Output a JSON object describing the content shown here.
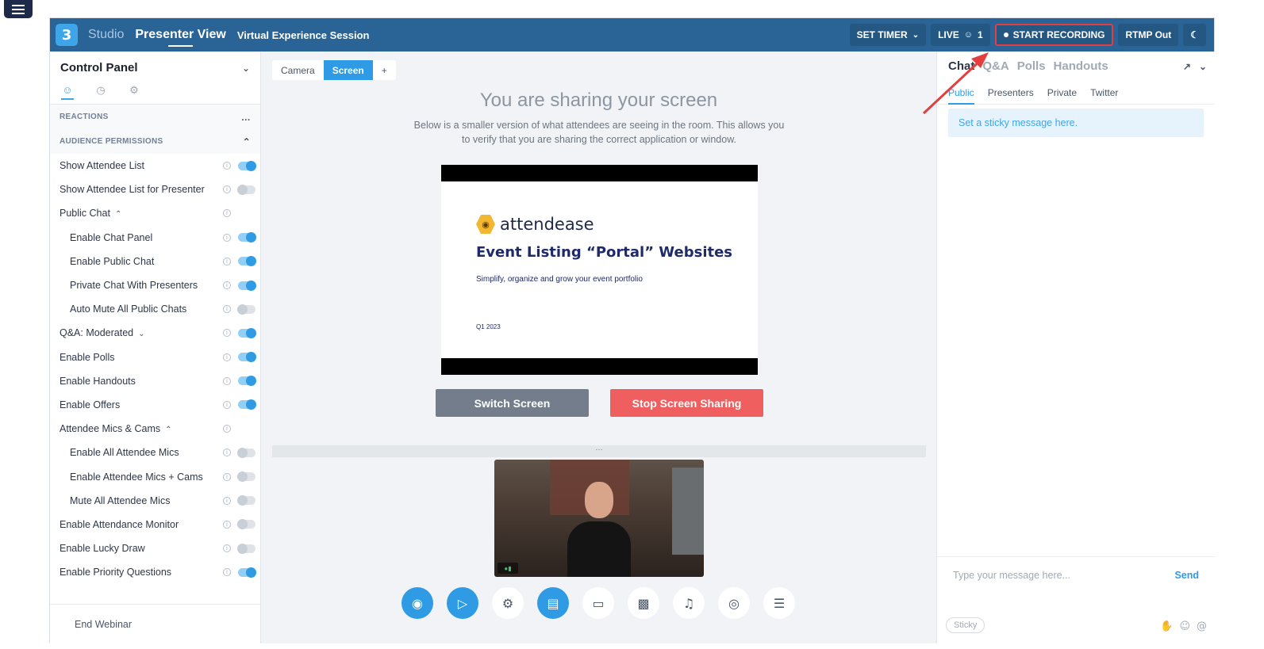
{
  "topbar": {
    "studio_label": "Studio",
    "presenter_view_label": "Presenter View",
    "session_title": "Virtual Experience Session",
    "set_timer_label": "SET TIMER",
    "live_label": "LIVE",
    "attendee_count": "1",
    "start_recording_label": "START RECORDING",
    "rtmp_label": "RTMP Out"
  },
  "control_panel": {
    "title": "Control Panel",
    "reactions_label": "REACTIONS",
    "reactions_more": "…",
    "audience_permissions_label": "AUDIENCE PERMISSIONS",
    "permissions": [
      {
        "label": "Show Attendee List",
        "on": true,
        "sub": false
      },
      {
        "label": "Show Attendee List for Presenter",
        "on": false,
        "sub": false
      },
      {
        "label": "Public Chat",
        "caret": "up",
        "sub": false,
        "toggle": false
      },
      {
        "label": "Enable Chat Panel",
        "on": true,
        "sub": true
      },
      {
        "label": "Enable Public Chat",
        "on": true,
        "sub": true
      },
      {
        "label": "Private Chat With Presenters",
        "on": true,
        "sub": true
      },
      {
        "label": "Auto Mute All Public Chats",
        "on": false,
        "sub": true
      },
      {
        "label": "Q&A: Moderated",
        "caret": "down",
        "on": true,
        "sub": false
      },
      {
        "label": "Enable Polls",
        "on": true,
        "sub": false
      },
      {
        "label": "Enable Handouts",
        "on": true,
        "sub": false
      },
      {
        "label": "Enable Offers",
        "on": true,
        "sub": false
      },
      {
        "label": "Attendee Mics & Cams",
        "caret": "up",
        "sub": false,
        "toggle": false
      },
      {
        "label": "Enable All Attendee Mics",
        "on": false,
        "sub": true
      },
      {
        "label": "Enable Attendee Mics + Cams",
        "on": false,
        "sub": true
      },
      {
        "label": "Mute All Attendee Mics",
        "on": false,
        "sub": true
      },
      {
        "label": "Enable Attendance Monitor",
        "on": false,
        "sub": false
      },
      {
        "label": "Enable Lucky Draw",
        "on": false,
        "sub": false
      },
      {
        "label": "Enable Priority Questions",
        "on": true,
        "sub": false
      }
    ],
    "end_webinar_label": "End Webinar"
  },
  "center": {
    "tabs": [
      "Camera",
      "Screen",
      "+"
    ],
    "share_title": "You are sharing your screen",
    "share_desc": "Below is a smaller version of what attendees are seeing in the room. This allows you to verify that you are sharing the correct application or window.",
    "slide": {
      "brand": "attendease",
      "title": "Event Listing “Portal” Websites",
      "subtitle": "Simplify, organize and grow your event portfolio",
      "date": "Q1 2023"
    },
    "switch_screen_label": "Switch Screen",
    "stop_sharing_label": "Stop Screen Sharing",
    "divider_handle": "…"
  },
  "chat": {
    "tabs": [
      "Chat",
      "Q&A",
      "Polls",
      "Handouts"
    ],
    "subtabs": [
      "Public",
      "Presenters",
      "Private",
      "Twitter"
    ],
    "sticky_message": "Set a sticky message here.",
    "input_placeholder": "Type your message here...",
    "send_label": "Send",
    "sticky_button": "Sticky"
  },
  "colors": {
    "topbar": "#2a6496",
    "accent": "#2f9be5",
    "stop": "#ef5f5f",
    "switch": "#737d8c",
    "annotation": "#e53e3e"
  }
}
